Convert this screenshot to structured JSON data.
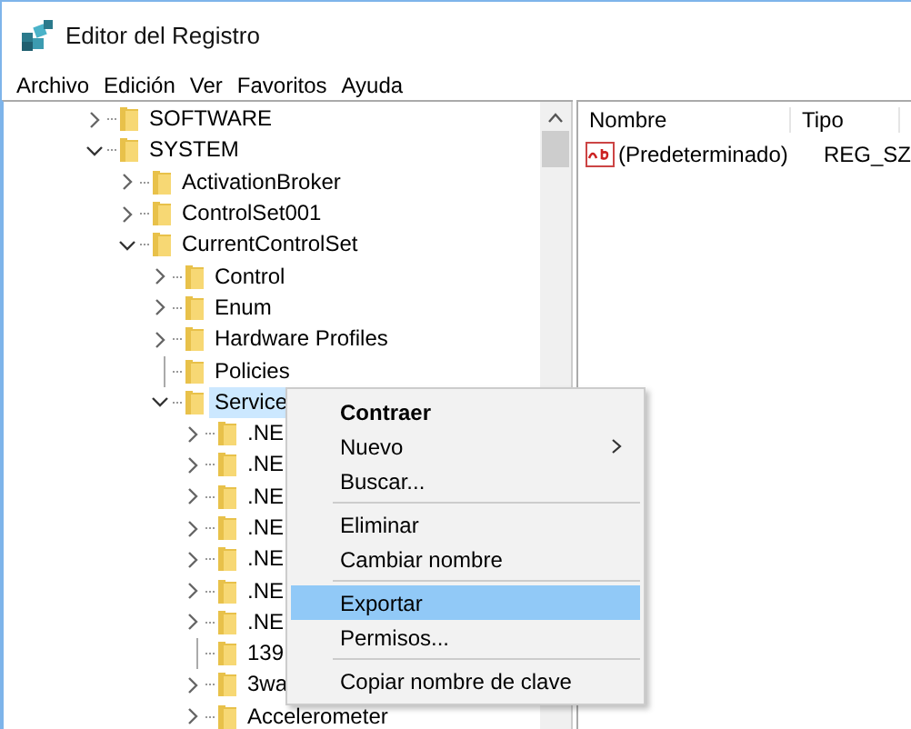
{
  "window": {
    "title": "Editor del Registro"
  },
  "menu_bar": [
    "Archivo",
    "Edición",
    "Ver",
    "Favoritos",
    "Ayuda"
  ],
  "tree": [
    {
      "label": "SOFTWARE",
      "expanded": false,
      "selected": false
    },
    {
      "label": "SYSTEM",
      "expanded": true,
      "selected": false,
      "children": [
        {
          "label": "ActivationBroker",
          "expanded": false,
          "selected": false
        },
        {
          "label": "ControlSet001",
          "expanded": false,
          "selected": false
        },
        {
          "label": "CurrentControlSet",
          "expanded": true,
          "selected": false,
          "children": [
            {
              "label": "Control",
              "expanded": false,
              "selected": false
            },
            {
              "label": "Enum",
              "expanded": false,
              "selected": false
            },
            {
              "label": "Hardware Profiles",
              "expanded": false,
              "selected": false
            },
            {
              "label": "Policies",
              "selected": false
            },
            {
              "label": "Service",
              "expanded": true,
              "selected": true,
              "children": [
                {
                  "label": ".NE",
                  "expanded": false,
                  "selected": false
                },
                {
                  "label": ".NE",
                  "expanded": false,
                  "selected": false
                },
                {
                  "label": ".NE",
                  "expanded": false,
                  "selected": false
                },
                {
                  "label": ".NE",
                  "expanded": false,
                  "selected": false
                },
                {
                  "label": ".NE",
                  "expanded": false,
                  "selected": false
                },
                {
                  "label": ".NE",
                  "expanded": false,
                  "selected": false
                },
                {
                  "label": ".NE",
                  "expanded": false,
                  "selected": false
                },
                {
                  "label": "139",
                  "selected": false
                },
                {
                  "label": "3wa",
                  "expanded": false,
                  "selected": false
                },
                {
                  "label": "Accelerometer",
                  "expanded": false,
                  "selected": false
                }
              ]
            }
          ]
        }
      ]
    }
  ],
  "list": {
    "columns": [
      "Nombre",
      "Tipo"
    ],
    "rows": [
      {
        "name": "(Predeterminado)",
        "type": "REG_SZ"
      }
    ]
  },
  "context_menu": [
    {
      "kind": "item",
      "label": "Contraer",
      "default": true,
      "submenu": false,
      "selected": false
    },
    {
      "kind": "item",
      "label": "Nuevo",
      "default": false,
      "submenu": true,
      "selected": false
    },
    {
      "kind": "item",
      "label": "Buscar...",
      "default": false,
      "submenu": false,
      "selected": false
    },
    {
      "kind": "separator"
    },
    {
      "kind": "item",
      "label": "Eliminar",
      "default": false,
      "submenu": false,
      "selected": false
    },
    {
      "kind": "item",
      "label": "Cambiar nombre",
      "default": false,
      "submenu": false,
      "selected": false
    },
    {
      "kind": "separator"
    },
    {
      "kind": "item",
      "label": "Exportar",
      "default": false,
      "submenu": false,
      "selected": true
    },
    {
      "kind": "item",
      "label": "Permisos...",
      "default": false,
      "submenu": false,
      "selected": false
    },
    {
      "kind": "separator"
    },
    {
      "kind": "item",
      "label": "Copiar nombre de clave",
      "default": false,
      "submenu": false,
      "selected": false
    }
  ]
}
